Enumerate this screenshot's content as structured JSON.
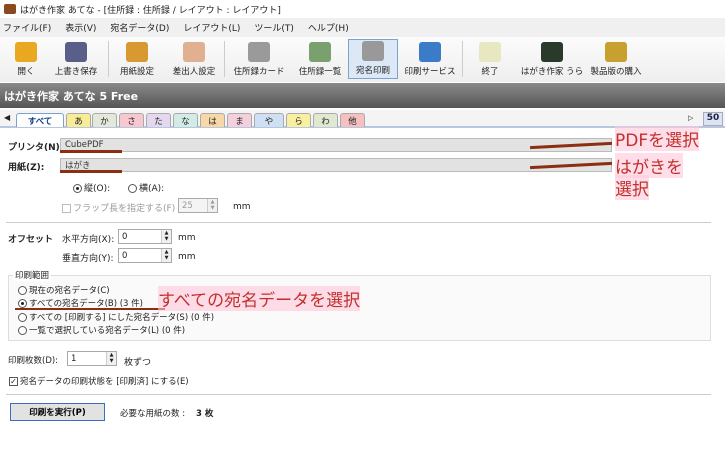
{
  "window": {
    "title": "はがき作家 あてな - [住所録 : 住所録 / レイアウト : レイアウト]"
  },
  "menu": [
    "ファイル(F)",
    "表示(V)",
    "宛名データ(D)",
    "レイアウト(L)",
    "ツール(T)",
    "ヘルプ(H)"
  ],
  "toolbar": [
    {
      "label": "開く",
      "icon": "folder-open-icon",
      "color": "#e8a820"
    },
    {
      "label": "上書き保存",
      "icon": "floppy-disk-icon",
      "color": "#5a5f8a"
    },
    {
      "label": "用紙設定",
      "icon": "paper-settings-icon",
      "color": "#d89a30"
    },
    {
      "label": "差出人設定",
      "icon": "sender-settings-icon",
      "color": "#e0b090"
    },
    {
      "label": "住所録カード",
      "icon": "address-cards-icon",
      "color": "#9a9a9a"
    },
    {
      "label": "住所録一覧",
      "icon": "address-list-icon",
      "color": "#7aa070"
    },
    {
      "label": "宛名印刷",
      "icon": "printer-icon",
      "color": "#999999"
    },
    {
      "label": "印刷サービス",
      "icon": "print-service-icon",
      "color": "#3b7bc8"
    },
    {
      "label": "終了",
      "icon": "tea-cup-exit-icon",
      "color": "#e8e8c0"
    },
    {
      "label": "はがき作家 うら",
      "icon": "hagaki-ura-icon",
      "color": "#2a3a2a"
    },
    {
      "label": "製品版の購入",
      "icon": "shopping-cart-icon",
      "color": "#c8a030"
    }
  ],
  "banner": "はがき作家 あてな 5 Free",
  "tabs": [
    {
      "label": "すべて",
      "color": "#ffffff"
    },
    {
      "label": "あ",
      "color": "#f8ec98"
    },
    {
      "label": "か",
      "color": "#e4e8d8"
    },
    {
      "label": "さ",
      "color": "#f8c8d0"
    },
    {
      "label": "た",
      "color": "#e4d8f0"
    },
    {
      "label": "な",
      "color": "#d0ece4"
    },
    {
      "label": "は",
      "color": "#f8d8a8"
    },
    {
      "label": "ま",
      "color": "#f4d0dc"
    },
    {
      "label": "や",
      "color": "#d0e0f4"
    },
    {
      "label": "ら",
      "color": "#f8f0a0"
    },
    {
      "label": "わ",
      "color": "#e0e8d0"
    },
    {
      "label": "他",
      "color": "#f4c0c0"
    }
  ],
  "tab_count": "50",
  "printer": {
    "label": "プリンタ(N):",
    "value": "CubePDF"
  },
  "paper": {
    "label": "用紙(Z):",
    "value": "はがき"
  },
  "orientation": {
    "portrait": "縦(O):",
    "landscape": "横(A):"
  },
  "flap": {
    "label": "フラップ長を指定する(F)",
    "value": "25",
    "unit": "mm"
  },
  "offset": {
    "label": "オフセット",
    "h_label": "水平方向(X):",
    "h_value": "0",
    "v_label": "垂直方向(Y):",
    "v_value": "0",
    "unit": "mm"
  },
  "range": {
    "title": "印刷範囲",
    "options": [
      "現在の宛名データ(C)",
      "すべての宛名データ(B) (3 件)",
      "すべての [印刷する] にした宛名データ(S) (0 件)",
      "一覧で選択している宛名データ(L) (0 件)"
    ]
  },
  "copies": {
    "label": "印刷枚数(D):",
    "value": "1",
    "unit": "枚ずつ"
  },
  "mark_printed": "宛名データの印刷状態を [印刷済] にする(E)",
  "print_button": "印刷を実行(P)",
  "required": {
    "label": "必要な用紙の数 :",
    "value": "3 枚"
  },
  "annotations": {
    "pdf": "PDFを選択",
    "hagaki1": "はがきを",
    "hagaki2": "選択",
    "all": "すべての宛名データを選択"
  }
}
